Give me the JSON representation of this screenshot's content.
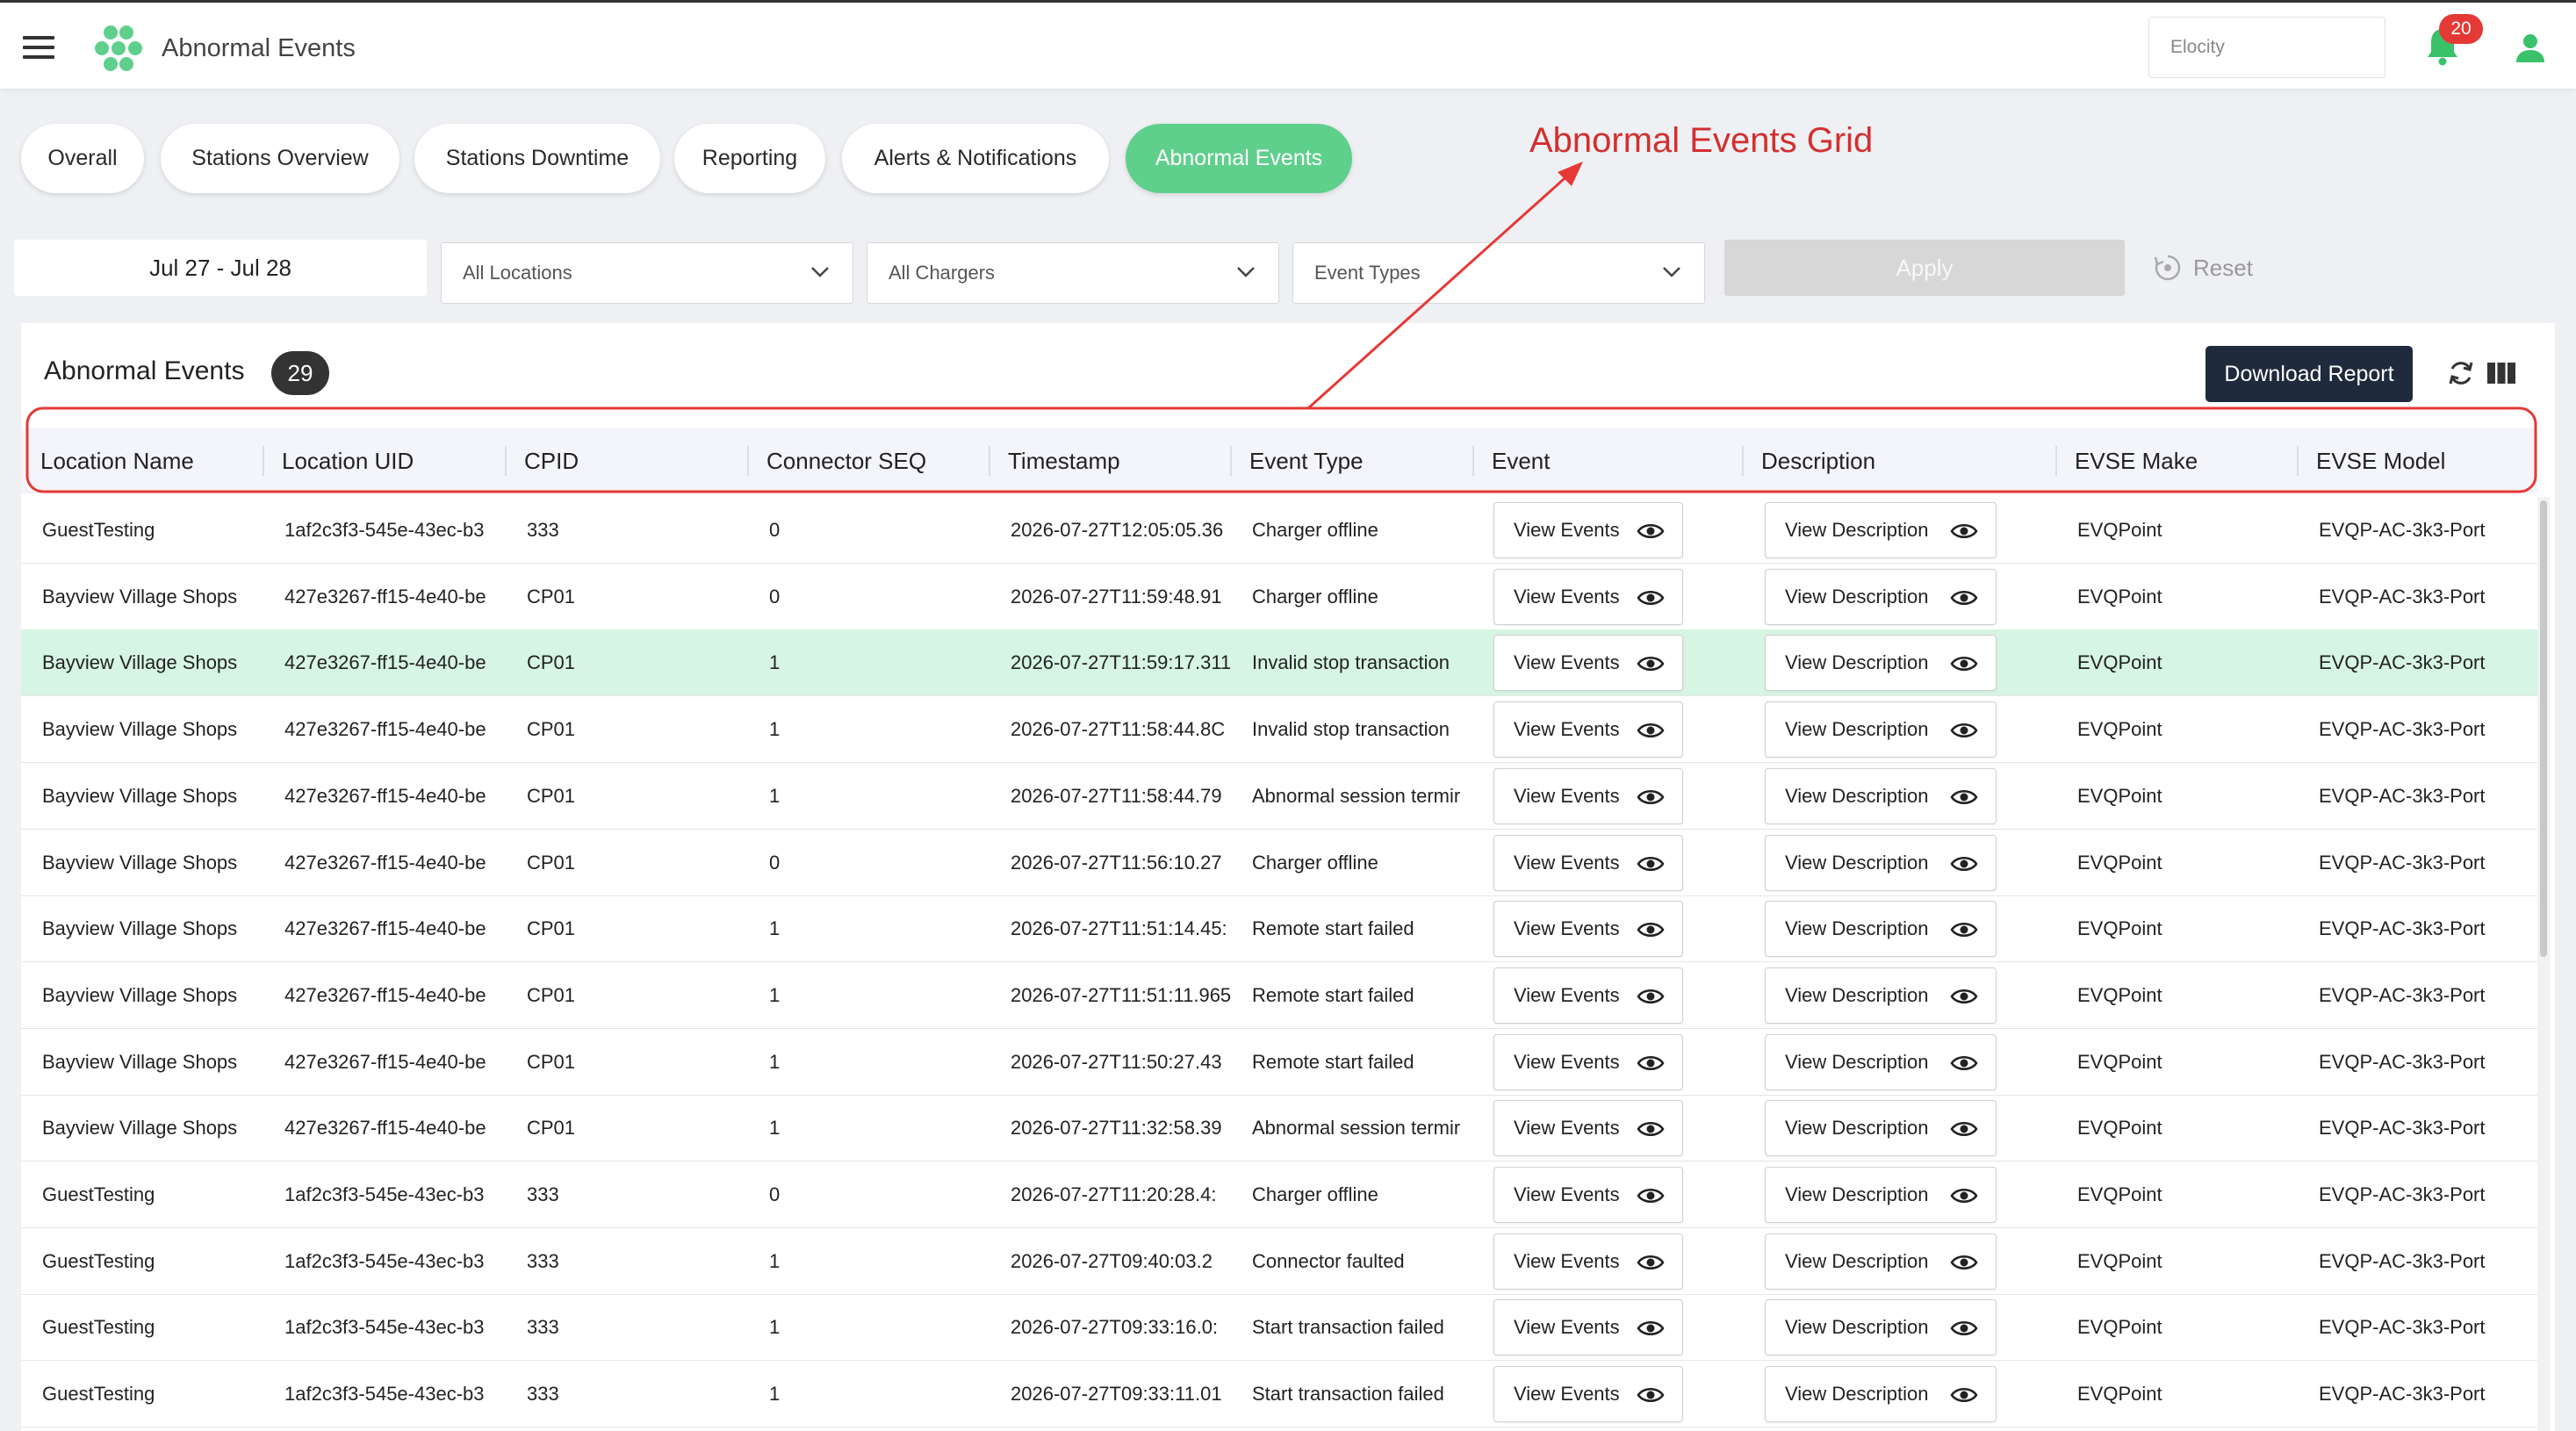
{
  "header": {
    "title": "Abnormal Events",
    "org_selector": "Elocity",
    "notifications_count": "20"
  },
  "tabs": [
    {
      "label": "Overall",
      "active": false
    },
    {
      "label": "Stations Overview",
      "active": false
    },
    {
      "label": "Stations Downtime",
      "active": false
    },
    {
      "label": "Reporting",
      "active": false
    },
    {
      "label": "Alerts & Notifications",
      "active": false
    },
    {
      "label": "Abnormal Events",
      "active": true
    }
  ],
  "annotation": {
    "text": "Abnormal Events Grid",
    "color": "#d32f2f"
  },
  "filters": {
    "date_range": "Jul 27 - Jul 28",
    "locations": "All Locations",
    "chargers": "All Chargers",
    "event_types": "Event Types",
    "apply_label": "Apply",
    "reset_label": "Reset"
  },
  "card": {
    "title": "Abnormal Events",
    "count": "29",
    "download_label": "Download Report"
  },
  "columns": [
    "Location Name",
    "Location UID",
    "CPID",
    "Connector SEQ",
    "Timestamp",
    "Event Type",
    "Event",
    "Description",
    "EVSE Make",
    "EVSE Model"
  ],
  "button_labels": {
    "events": "View Events",
    "description": "View Description"
  },
  "rows": [
    {
      "location_name": "GuestTesting",
      "location_uid": "1af2c3f3-545e-43ec-b3",
      "cpid": "333",
      "connector_seq": "0",
      "timestamp": "2026-07-27T12:05:05.36",
      "event_type": "Charger offline",
      "evse_make": "EVQPoint",
      "evse_model": "EVQP-AC-3k3-Port",
      "highlighted": false
    },
    {
      "location_name": "Bayview Village Shops",
      "location_uid": "427e3267-ff15-4e40-be",
      "cpid": "CP01",
      "connector_seq": "0",
      "timestamp": "2026-07-27T11:59:48.91",
      "event_type": "Charger offline",
      "evse_make": "EVQPoint",
      "evse_model": "EVQP-AC-3k3-Port",
      "highlighted": false
    },
    {
      "location_name": "Bayview Village Shops",
      "location_uid": "427e3267-ff15-4e40-be",
      "cpid": "CP01",
      "connector_seq": "1",
      "timestamp": "2026-07-27T11:59:17.311",
      "event_type": "Invalid stop transaction",
      "evse_make": "EVQPoint",
      "evse_model": "EVQP-AC-3k3-Port",
      "highlighted": true
    },
    {
      "location_name": "Bayview Village Shops",
      "location_uid": "427e3267-ff15-4e40-be",
      "cpid": "CP01",
      "connector_seq": "1",
      "timestamp": "2026-07-27T11:58:44.8C",
      "event_type": "Invalid stop transaction",
      "evse_make": "EVQPoint",
      "evse_model": "EVQP-AC-3k3-Port",
      "highlighted": false
    },
    {
      "location_name": "Bayview Village Shops",
      "location_uid": "427e3267-ff15-4e40-be",
      "cpid": "CP01",
      "connector_seq": "1",
      "timestamp": "2026-07-27T11:58:44.79",
      "event_type": "Abnormal session termir",
      "evse_make": "EVQPoint",
      "evse_model": "EVQP-AC-3k3-Port",
      "highlighted": false
    },
    {
      "location_name": "Bayview Village Shops",
      "location_uid": "427e3267-ff15-4e40-be",
      "cpid": "CP01",
      "connector_seq": "0",
      "timestamp": "2026-07-27T11:56:10.27",
      "event_type": "Charger offline",
      "evse_make": "EVQPoint",
      "evse_model": "EVQP-AC-3k3-Port",
      "highlighted": false
    },
    {
      "location_name": "Bayview Village Shops",
      "location_uid": "427e3267-ff15-4e40-be",
      "cpid": "CP01",
      "connector_seq": "1",
      "timestamp": "2026-07-27T11:51:14.45:",
      "event_type": "Remote start failed",
      "evse_make": "EVQPoint",
      "evse_model": "EVQP-AC-3k3-Port",
      "highlighted": false
    },
    {
      "location_name": "Bayview Village Shops",
      "location_uid": "427e3267-ff15-4e40-be",
      "cpid": "CP01",
      "connector_seq": "1",
      "timestamp": "2026-07-27T11:51:11.965",
      "event_type": "Remote start failed",
      "evse_make": "EVQPoint",
      "evse_model": "EVQP-AC-3k3-Port",
      "highlighted": false
    },
    {
      "location_name": "Bayview Village Shops",
      "location_uid": "427e3267-ff15-4e40-be",
      "cpid": "CP01",
      "connector_seq": "1",
      "timestamp": "2026-07-27T11:50:27.43",
      "event_type": "Remote start failed",
      "evse_make": "EVQPoint",
      "evse_model": "EVQP-AC-3k3-Port",
      "highlighted": false
    },
    {
      "location_name": "Bayview Village Shops",
      "location_uid": "427e3267-ff15-4e40-be",
      "cpid": "CP01",
      "connector_seq": "1",
      "timestamp": "2026-07-27T11:32:58.39",
      "event_type": "Abnormal session termir",
      "evse_make": "EVQPoint",
      "evse_model": "EVQP-AC-3k3-Port",
      "highlighted": false
    },
    {
      "location_name": "GuestTesting",
      "location_uid": "1af2c3f3-545e-43ec-b3",
      "cpid": "333",
      "connector_seq": "0",
      "timestamp": "2026-07-27T11:20:28.4:",
      "event_type": "Charger offline",
      "evse_make": "EVQPoint",
      "evse_model": "EVQP-AC-3k3-Port",
      "highlighted": false
    },
    {
      "location_name": "GuestTesting",
      "location_uid": "1af2c3f3-545e-43ec-b3",
      "cpid": "333",
      "connector_seq": "1",
      "timestamp": "2026-07-27T09:40:03.2",
      "event_type": "Connector faulted",
      "evse_make": "EVQPoint",
      "evse_model": "EVQP-AC-3k3-Port",
      "highlighted": false
    },
    {
      "location_name": "GuestTesting",
      "location_uid": "1af2c3f3-545e-43ec-b3",
      "cpid": "333",
      "connector_seq": "1",
      "timestamp": "2026-07-27T09:33:16.0:",
      "event_type": "Start transaction failed",
      "evse_make": "EVQPoint",
      "evse_model": "EVQP-AC-3k3-Port",
      "highlighted": false
    },
    {
      "location_name": "GuestTesting",
      "location_uid": "1af2c3f3-545e-43ec-b3",
      "cpid": "333",
      "connector_seq": "1",
      "timestamp": "2026-07-27T09:33:11.01",
      "event_type": "Start transaction failed",
      "evse_make": "EVQPoint",
      "evse_model": "EVQP-AC-3k3-Port",
      "highlighted": false
    }
  ],
  "colors": {
    "accent": "#5fcf8c",
    "row_highlight": "#d6f5e3",
    "download_button": "#1f2a3c",
    "notification_badge": "#e53935"
  }
}
